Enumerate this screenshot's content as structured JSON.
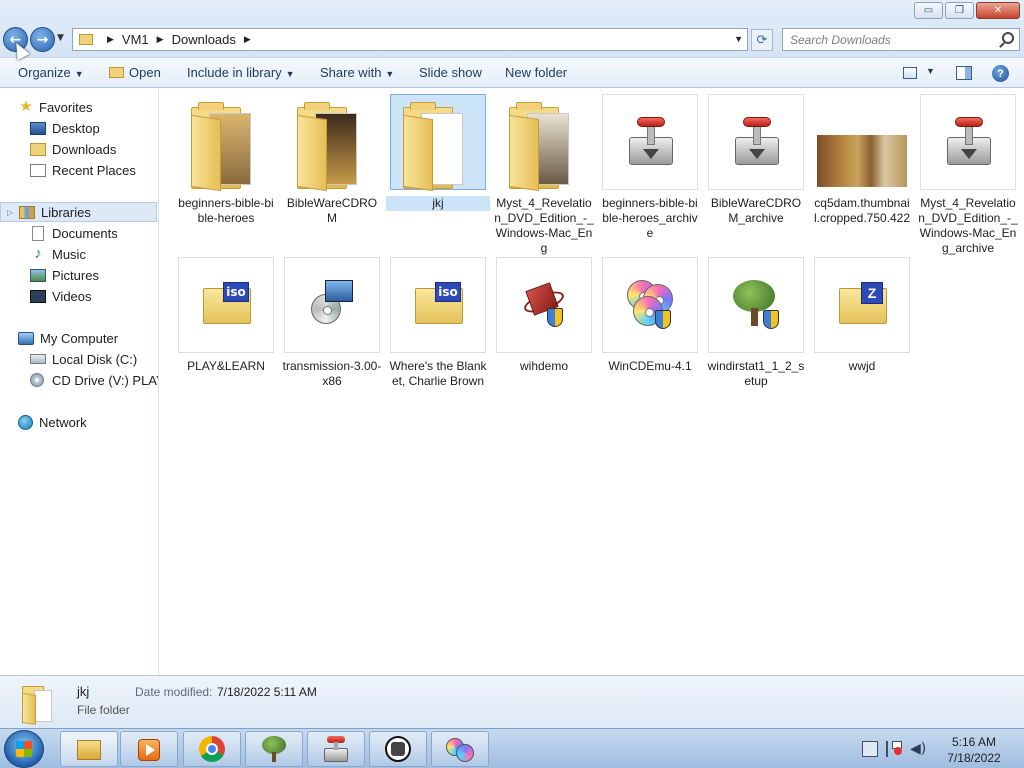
{
  "window": {
    "minimize_glyph": "▭",
    "maximize_glyph": "❐",
    "close_glyph": "✕"
  },
  "address": {
    "crumbs": [
      "VM1",
      "Downloads"
    ],
    "search_placeholder": "Search Downloads"
  },
  "toolbar": {
    "organize": "Organize",
    "open": "Open",
    "include_in_library": "Include in library",
    "share_with": "Share with",
    "slide_show": "Slide show",
    "new_folder": "New folder",
    "help_glyph": "?"
  },
  "nav": {
    "favorites": "Favorites",
    "desktop": "Desktop",
    "downloads": "Downloads",
    "recent_places": "Recent Places",
    "libraries": "Libraries",
    "documents": "Documents",
    "music": "Music",
    "pictures": "Pictures",
    "videos": "Videos",
    "my_computer": "My Computer",
    "local_disk": "Local Disk (C:)",
    "cd_drive": "CD Drive (V:) PLAY&",
    "network": "Network"
  },
  "files": [
    {
      "name": "beginners-bible-bible-heroes",
      "icon": "folder-icon"
    },
    {
      "name": "BibleWareCDROM",
      "icon": "folder-icon"
    },
    {
      "name": "jkj",
      "icon": "folder-icon",
      "selected": true
    },
    {
      "name": "Myst_4_Revelation_DVD_Edition_-_Windows-Mac_Eng",
      "icon": "folder-icon"
    },
    {
      "name": "beginners-bible-bible-heroes_archive",
      "icon": "transmission-icon"
    },
    {
      "name": "BibleWareCDROM_archive",
      "icon": "transmission-icon"
    },
    {
      "name": "cq5dam.thumbnail.cropped.750.422",
      "icon": "image-thumbnail"
    },
    {
      "name": "Myst_4_Revelation_DVD_Edition_-_Windows-Mac_Eng_archive",
      "icon": "transmission-icon"
    },
    {
      "name": "PLAY&LEARN",
      "icon": "iso-icon"
    },
    {
      "name": "transmission-3.00-x86",
      "icon": "installer-icon"
    },
    {
      "name": "Where's the Blanket, Charlie Brown",
      "icon": "iso-icon"
    },
    {
      "name": "wihdemo",
      "icon": "wihdemo-icon"
    },
    {
      "name": "WinCDEmu-4.1",
      "icon": "wincdemu-icon"
    },
    {
      "name": "windirstat1_1_2_setup",
      "icon": "windirstat-icon"
    },
    {
      "name": "wwjd",
      "icon": "zip-icon"
    }
  ],
  "details": {
    "name": "jkj",
    "type": "File folder",
    "date_label": "Date modified:",
    "date_value": "7/18/2022 5:11 AM"
  },
  "taskbar": {
    "time": "5:16 AM",
    "date": "7/18/2022"
  },
  "colors": {
    "selection": "#cce4f7",
    "toolbar_text": "#1e3a5f",
    "taskbar": "#9fbde0"
  }
}
